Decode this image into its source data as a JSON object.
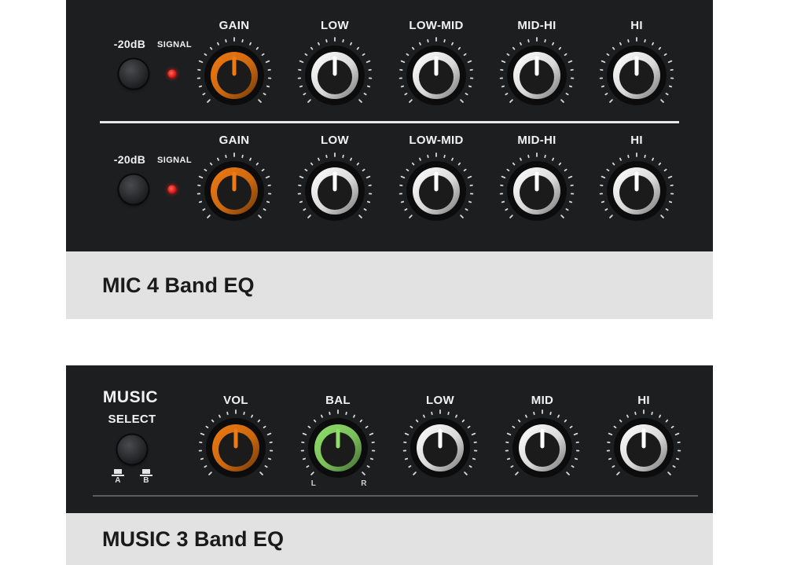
{
  "mic_section": {
    "caption": "MIC 4 Band EQ",
    "channels": [
      {
        "pad_label": "-20dB",
        "signal_label": "SIGNAL",
        "knobs": [
          {
            "label": "GAIN",
            "color": "#f07a12"
          },
          {
            "label": "LOW",
            "color": "#ffffff"
          },
          {
            "label": "LOW-MID",
            "color": "#ffffff"
          },
          {
            "label": "MID-HI",
            "color": "#ffffff"
          },
          {
            "label": "HI",
            "color": "#ffffff"
          }
        ]
      },
      {
        "pad_label": "-20dB",
        "signal_label": "SIGNAL",
        "knobs": [
          {
            "label": "GAIN",
            "color": "#f07a12"
          },
          {
            "label": "LOW",
            "color": "#ffffff"
          },
          {
            "label": "LOW-MID",
            "color": "#ffffff"
          },
          {
            "label": "MID-HI",
            "color": "#ffffff"
          },
          {
            "label": "HI",
            "color": "#ffffff"
          }
        ]
      }
    ]
  },
  "music_section": {
    "caption": "MUSIC 3 Band EQ",
    "music_label": "MUSIC",
    "select_label": "SELECT",
    "select_a": "A",
    "select_b": "B",
    "bal_left": "L",
    "bal_right": "R",
    "knobs": [
      {
        "label": "VOL",
        "color": "#f07a12"
      },
      {
        "label": "BAL",
        "color": "#8fe06a"
      },
      {
        "label": "LOW",
        "color": "#ffffff"
      },
      {
        "label": "MID",
        "color": "#ffffff"
      },
      {
        "label": "HI",
        "color": "#ffffff"
      }
    ]
  },
  "colors": {
    "panel": "#1d1e20",
    "caption_bg": "#e2e2e2",
    "led": "#e01818"
  }
}
